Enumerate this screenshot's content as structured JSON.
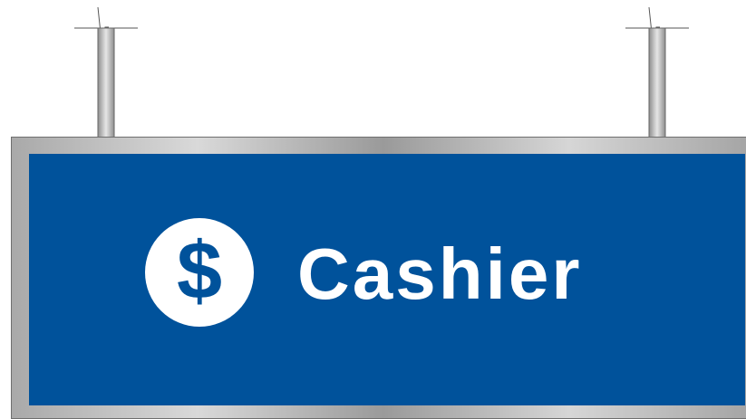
{
  "sign": {
    "label": "Cashier",
    "icon": "dollar-icon",
    "icon_glyph": "$",
    "colors": {
      "panel": "#00529b",
      "text": "#ffffff",
      "frame": "#b5b5b5"
    }
  }
}
